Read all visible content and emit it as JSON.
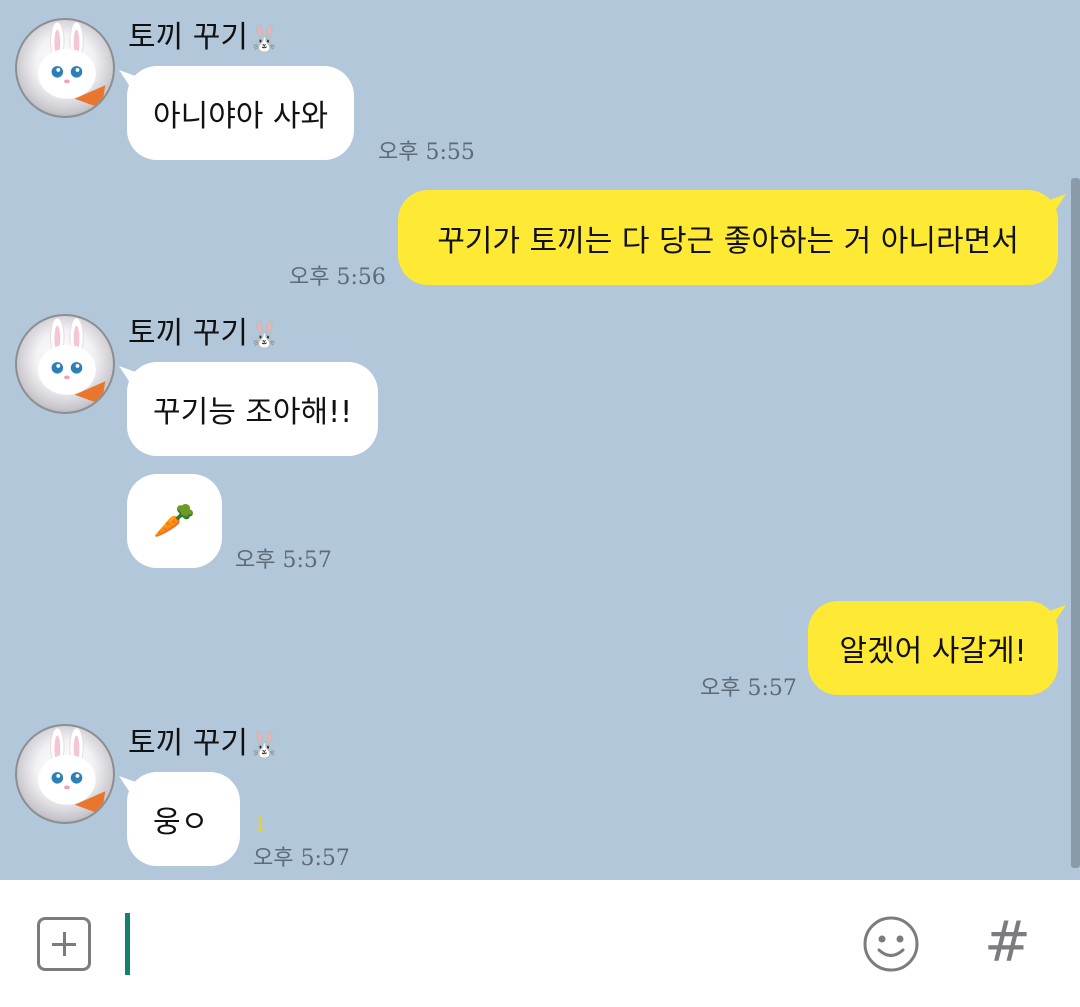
{
  "contact": {
    "name": "토끼 꾸기",
    "name_emoji": "🐰"
  },
  "messages": [
    {
      "direction": "in",
      "show_sender": true,
      "text": "아니야아 사와",
      "time": "오후 5:55"
    },
    {
      "direction": "out",
      "text": "꾸기가 토끼는 다 당근 좋아하는 거 아니라면서",
      "time": "오후 5:56"
    },
    {
      "direction": "in",
      "show_sender": true,
      "text": "꾸기능 조아해!!",
      "time": ""
    },
    {
      "direction": "in",
      "text": "🥕",
      "time": "오후 5:57"
    },
    {
      "direction": "out",
      "text": "알겠어 사갈게!",
      "time": "오후 5:57"
    },
    {
      "direction": "in",
      "show_sender": true,
      "text": "웅ㅇ",
      "time": "오후 5:57",
      "unread": "1"
    }
  ],
  "input": {
    "plus_icon": "plus-square-icon",
    "emoji_icon": "smiley-icon",
    "hash_label": "#"
  },
  "colors": {
    "chat_background": "#b2c7da",
    "incoming_bubble": "#ffffff",
    "outgoing_bubble": "#fee934",
    "cursor": "#16806f",
    "unread": "#e6d23b"
  }
}
